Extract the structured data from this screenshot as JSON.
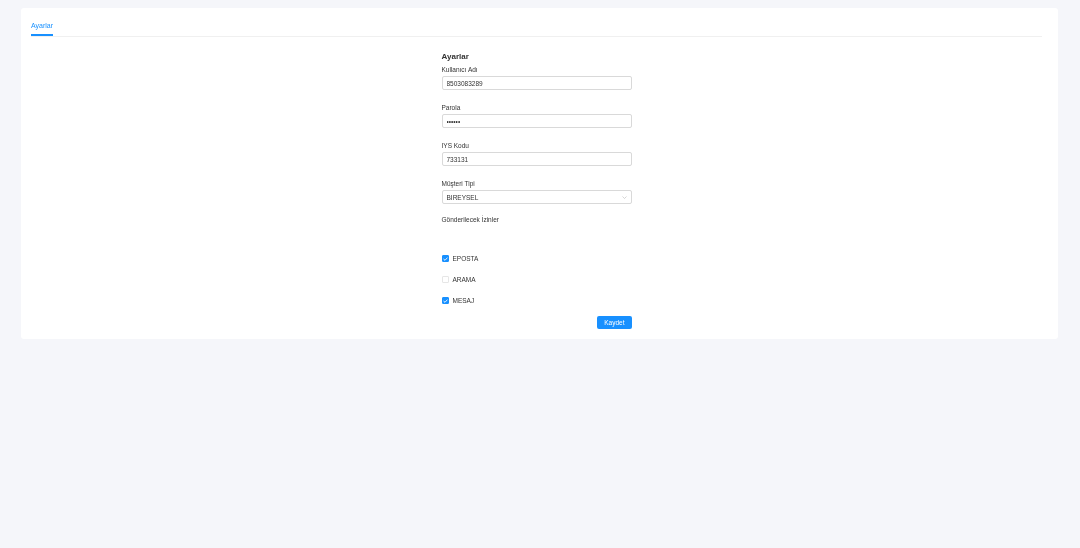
{
  "tabs": [
    {
      "label": "Ayarlar",
      "selected": true
    }
  ],
  "form": {
    "title": "Ayarlar",
    "fields": [
      {
        "kind": "text",
        "label": "Kullanıcı Adı",
        "value": "8503083289"
      },
      {
        "kind": "text",
        "label": "Parola",
        "value": "••••••"
      },
      {
        "kind": "text",
        "label": "IYS Kodu",
        "value": "733131"
      },
      {
        "kind": "select",
        "label": "Müşteri Tipi",
        "value": "BIREYSEL"
      }
    ],
    "permissions_label": "Gönderilecek İzinler",
    "permissions": [
      {
        "label": "EPOSTA",
        "checked": true
      },
      {
        "label": "ARAMA",
        "checked": false
      },
      {
        "label": "MESAJ",
        "checked": true
      }
    ],
    "submit": "Kaydet"
  }
}
